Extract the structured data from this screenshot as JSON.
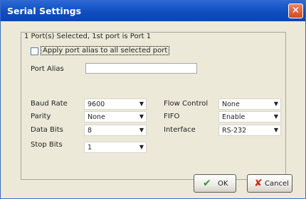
{
  "window": {
    "title": "Serial Settings"
  },
  "header_text": "1 Port(s) Selected, 1st port is Port 1",
  "apply_alias_label": "Apply port alias to all selected port",
  "port_alias": {
    "label": "Port Alias",
    "value": ""
  },
  "fields": {
    "baud_rate": {
      "label": "Baud Rate",
      "value": "9600"
    },
    "parity": {
      "label": "Parity",
      "value": "None"
    },
    "data_bits": {
      "label": "Data Bits",
      "value": "8"
    },
    "stop_bits": {
      "label": "Stop Bits",
      "value": "1"
    },
    "flow_control": {
      "label": "Flow Control",
      "value": "None"
    },
    "fifo": {
      "label": "FIFO",
      "value": "Enable"
    },
    "interface": {
      "label": "Interface",
      "value": "RS-232"
    }
  },
  "buttons": {
    "ok": "OK",
    "cancel": "Cancel"
  },
  "colors": {
    "title_bar": "#0f4ec0",
    "close_button": "#d5481f",
    "ok_check": "#2e9b2e",
    "cancel_x": "#c8321f"
  }
}
